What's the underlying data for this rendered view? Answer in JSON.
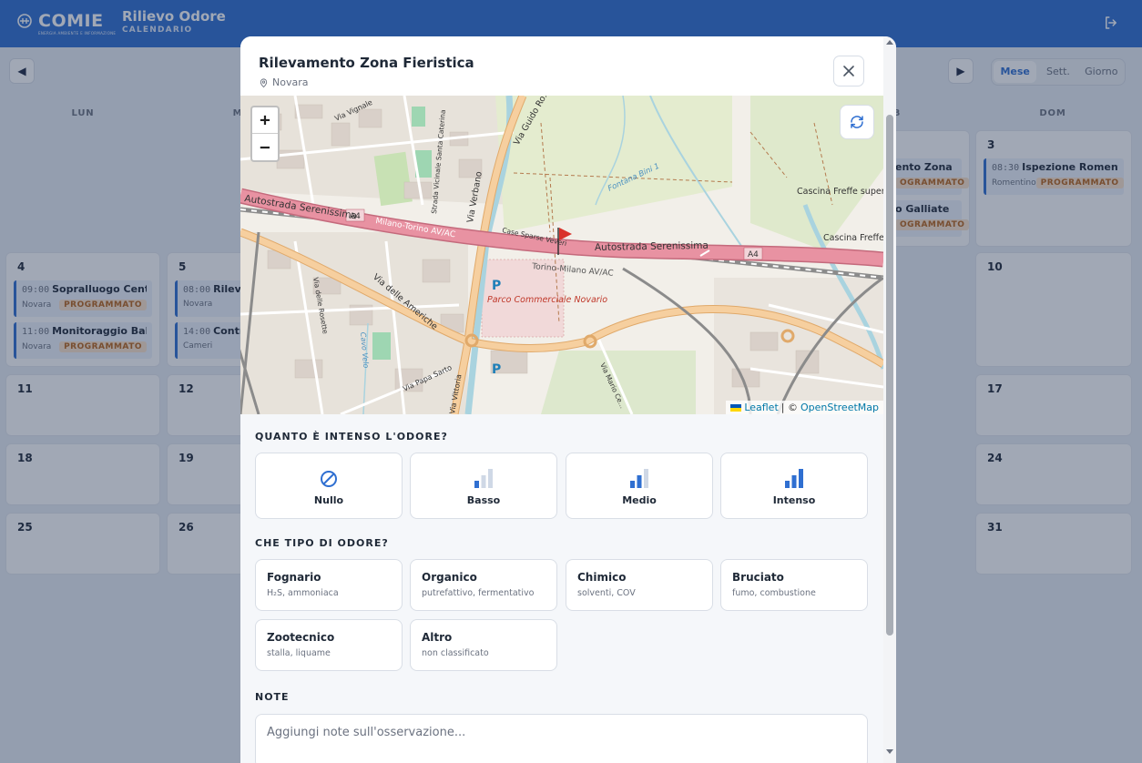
{
  "app": {
    "logo_text": "COMIE",
    "logo_sub": "ENERGIA AMBIENTE E INFORMAZIONE",
    "title": "Rilievo Odore",
    "subtitle": "CALENDARIO"
  },
  "calendar": {
    "views": [
      "Mese",
      "Sett.",
      "Giorno"
    ],
    "active_view": "Mese",
    "weekdays": [
      "LUN",
      "M",
      "",
      "",
      "",
      "B",
      "DOM"
    ],
    "days": {
      "d3": "3",
      "d4": "4",
      "d5": "5",
      "d10": "10",
      "d11": "11",
      "d12": "12",
      "d17": "17",
      "d18": "18",
      "d19": "19",
      "d24": "24",
      "d25": "25",
      "d26": "26",
      "d31": "31"
    },
    "events": {
      "sun3_a": {
        "time": "08:30",
        "title": "Ispezione Romentino",
        "place": "Romentino",
        "status": "PROGRAMMATO"
      },
      "sat2_a": {
        "title": "ento Zona ...",
        "status": "OGRAMMATO"
      },
      "sat2_b": {
        "title": "o Galliate",
        "status": "OGRAMMATO"
      },
      "mon4_a": {
        "time": "09:00",
        "title": "Sopralluogo Centro...",
        "place": "Novara",
        "status": "PROGRAMMATO"
      },
      "mon4_b": {
        "time": "11:00",
        "title": "Monitoraggio Balua...",
        "place": "Novara",
        "status": "PROGRAMMATO"
      },
      "tue5_a": {
        "time": "08:00",
        "title": "Rileva",
        "place": "Novara"
      },
      "tue5_b": {
        "time": "14:00",
        "title": "Contr",
        "place": "Cameri"
      }
    }
  },
  "modal": {
    "title": "Rilevamento Zona Fieristica",
    "location": "Novara",
    "map": {
      "zoom_in": "+",
      "zoom_out": "−",
      "attribution_leaflet": "Leaflet",
      "attribution_sep": "| ©",
      "attribution_osm": "OpenStreetMap",
      "labels": {
        "autostrada1": "Autostrada Serenissima",
        "autostrada2": "Autostrada Serenissima",
        "a4_1": "A4",
        "a4_2": "A4",
        "milano_torino": "Milano-Torino AV/AC",
        "torino_milano": "Torino-Milano AV/AC",
        "via_americhe": "Via delle Americhe",
        "via_verbano": "Via Verbano",
        "via_guido": "Via Guido Ro...",
        "via_vignale": "Via Vignale",
        "strada_vicinale": "Strada Vicinale Santa Caterina",
        "parco": "Parco Commerciale Novario",
        "cascina1": "Cascina Freffe superiore",
        "cascina2": "Cascina Freffe inferiore",
        "fontana": "Fontana Bini 1",
        "case_sparse": "Case Sparse Veveri",
        "via_papa": "Via Papa Sarto",
        "via_vittoria": "Via Vittoria",
        "via_rosette": "Via delle Rosette",
        "via_mario": "Via Mario Ce...",
        "cavo": "Cavo Velo",
        "parking": "P"
      }
    },
    "intensity": {
      "label": "QUANTO È INTENSO L'ODORE?",
      "options": [
        {
          "label": "Nullo",
          "icon": "no-symbol-icon"
        },
        {
          "label": "Basso",
          "icon": "signal-low-icon"
        },
        {
          "label": "Medio",
          "icon": "signal-medium-icon"
        },
        {
          "label": "Intenso",
          "icon": "signal-high-icon"
        }
      ]
    },
    "odor_type": {
      "label": "CHE TIPO DI ODORE?",
      "options": [
        {
          "name": "Fognario",
          "desc": "H₂S, ammoniaca"
        },
        {
          "name": "Organico",
          "desc": "putrefattivo, fermentativo"
        },
        {
          "name": "Chimico",
          "desc": "solventi, COV"
        },
        {
          "name": "Bruciato",
          "desc": "fumo, combustione"
        },
        {
          "name": "Zootecnico",
          "desc": "stalla, liquame"
        },
        {
          "name": "Altro",
          "desc": "non classificato"
        }
      ]
    },
    "notes": {
      "label": "NOTE",
      "placeholder": "Aggiungi note sull'osservazione..."
    }
  },
  "colors": {
    "primary": "#2f6fd1",
    "badge_text": "#b8641a",
    "badge_bg": "#fbe4cc",
    "highway": "#e892a2",
    "road": "#f6cf9f"
  }
}
